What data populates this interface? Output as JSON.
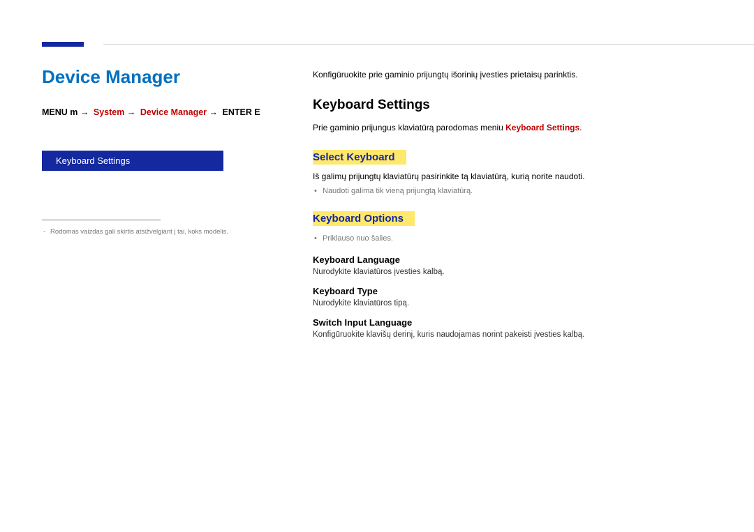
{
  "left": {
    "title": "Device Manager",
    "crumb": {
      "p1": "MENU",
      "p2": "m",
      "arrow": "→",
      "p3": "System",
      "p4": "Device Manager",
      "p5": "ENTER",
      "p6": "E"
    },
    "panel": "Keyboard Settings",
    "disclaimer": "Rodomas vaizdas gali skirtis atsižvelgiant į tai, koks modelis."
  },
  "right": {
    "intro": "Konfigūruokite prie gaminio prijungtų išorinių įvesties prietaisų parinktis.",
    "h2": "Keyboard Settings",
    "p2a": "Prie gaminio prijungus klaviatūrą parodomas meniu ",
    "p2b": "Keyboard Settings",
    "p2c": ".",
    "select": {
      "h": "Select Keyboard",
      "p": "Iš galimų prijungtų klaviatūrų pasirinkite tą klaviatūrą, kurią norite naudoti.",
      "b": "Naudoti galima tik vieną prijungtą klaviatūrą."
    },
    "options": {
      "h": "Keyboard Options",
      "b": "Priklauso nuo šalies.",
      "lang_h": "Keyboard Language",
      "lang_p": "Nurodykite klaviatūros įvesties kalbą.",
      "type_h": "Keyboard Type",
      "type_p": "Nurodykite klaviatūros tipą.",
      "switch_h": "Switch Input Language",
      "switch_p": "Konfigūruokite klavišų derinį, kuris naudojamas norint pakeisti įvesties kalbą."
    }
  }
}
